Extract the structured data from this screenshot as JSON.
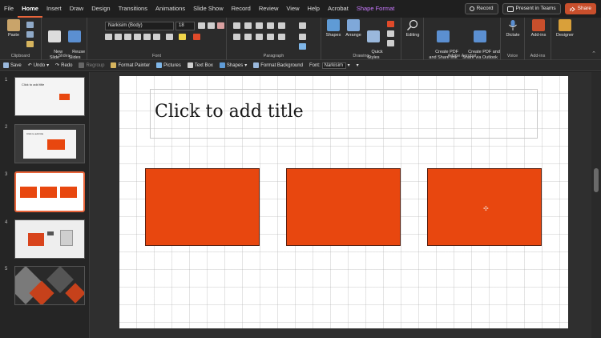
{
  "menu": {
    "items": [
      "File",
      "Home",
      "Insert",
      "Draw",
      "Design",
      "Transitions",
      "Animations",
      "Slide Show",
      "Record",
      "Review",
      "View",
      "Help",
      "Acrobat"
    ],
    "active": "Home",
    "contextual_tab": "Shape Format",
    "record_label": "Record",
    "present_label": "Present in Teams",
    "share_label": "Share"
  },
  "ribbon": {
    "clipboard": {
      "paste_label": "Paste",
      "group_label": "Clipboard"
    },
    "slides": {
      "new_slide_label": "New\nSlide",
      "reuse_slides_label": "Reuse\nSlides",
      "group_label": "Slides"
    },
    "font": {
      "font_name": "Narkisim (Body)",
      "font_size": "18",
      "group_label": "Font"
    },
    "paragraph": {
      "group_label": "Paragraph"
    },
    "drawing": {
      "shapes_label": "Shapes",
      "arrange_label": "Arrange",
      "quick_styles_label": "Quick\nStyles",
      "group_label": "Drawing"
    },
    "editing": {
      "editing_label": "Editing"
    },
    "adobe": {
      "create_pdf_share_link_label": "Create PDF\nand Share link",
      "create_pdf_outlook_label": "Create PDF and\nShare via Outlook",
      "group_label": "Adobe Acrobat"
    },
    "voice": {
      "dictate_label": "Dictate",
      "group_label": "Voice"
    },
    "addins": {
      "addins_label": "Add-ins",
      "group_label": "Add-ins"
    },
    "designer": {
      "designer_label": "Designer"
    }
  },
  "qat": {
    "save": "Save",
    "undo": "Undo",
    "redo": "Redo",
    "regroup": "Regroup",
    "format_painter": "Format Painter",
    "pictures": "Pictures",
    "text_box": "Text Box",
    "shapes": "Shapes",
    "format_background": "Format Background",
    "font_label": "Font:",
    "font_value": "Narkisim"
  },
  "thumbnails": {
    "numbers": [
      "1",
      "2",
      "3",
      "4",
      "5"
    ],
    "selected_index": 3,
    "slide1_title": "Click to add title",
    "slide2_title": "Click to add title"
  },
  "slide": {
    "title_placeholder": "Click to add title",
    "shape_color": "#E8470F",
    "shape_count": 3
  },
  "colors": {
    "accent": "#E8643A",
    "ribbon_bg": "#2B2B2B",
    "app_bg": "#1F1F1F"
  }
}
